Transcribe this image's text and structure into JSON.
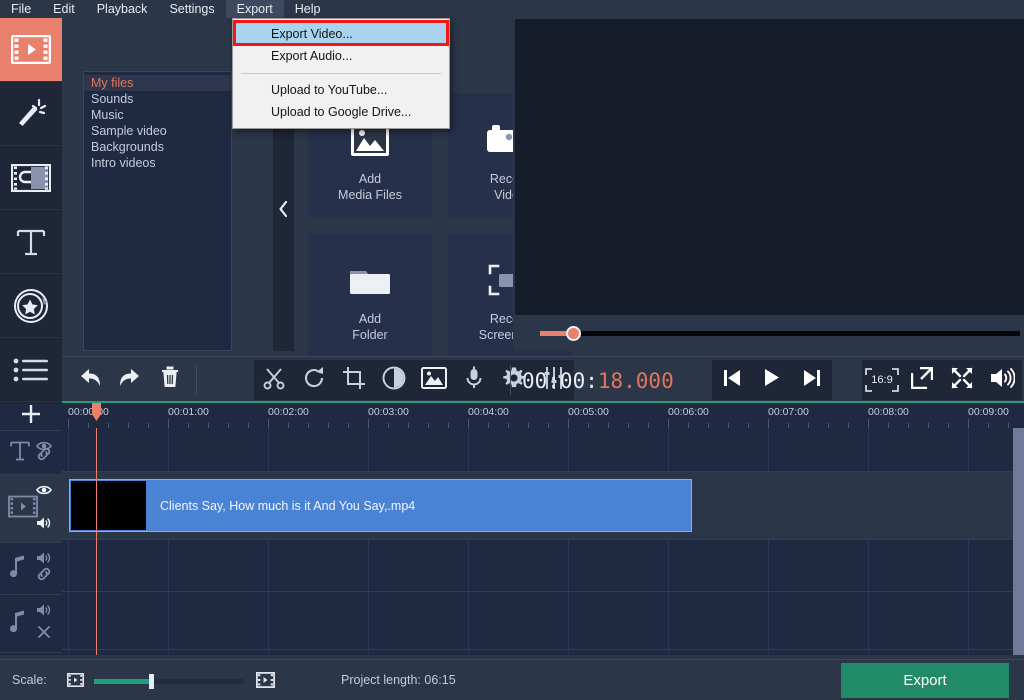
{
  "app": {
    "accent_salmon": "#e8806b",
    "accent_green": "#218b68",
    "clip_blue": "#4a82d4"
  },
  "menubar": {
    "items": [
      {
        "label": "File"
      },
      {
        "label": "Edit"
      },
      {
        "label": "Playback"
      },
      {
        "label": "Settings"
      },
      {
        "label": "Export"
      },
      {
        "label": "Help"
      }
    ]
  },
  "dropdown": {
    "items": [
      {
        "label": "Export Video...",
        "highlighted": true
      },
      {
        "label": "Export Audio...",
        "highlighted": false
      },
      {
        "label": "Upload to YouTube...",
        "highlighted": false
      },
      {
        "label": "Upload to Google Drive...",
        "highlighted": false
      }
    ]
  },
  "rail": {
    "items": [
      {
        "name": "import",
        "selected": true
      },
      {
        "name": "filters",
        "selected": false
      },
      {
        "name": "transitions",
        "selected": false
      },
      {
        "name": "titles",
        "selected": false
      },
      {
        "name": "stickers",
        "selected": false
      },
      {
        "name": "more",
        "selected": false
      }
    ]
  },
  "media_panel": {
    "file_list": [
      {
        "label": "My files",
        "selected": true
      },
      {
        "label": "Sounds",
        "selected": false
      },
      {
        "label": "Music",
        "selected": false
      },
      {
        "label": "Sample video",
        "selected": false
      },
      {
        "label": "Backgrounds",
        "selected": false
      },
      {
        "label": "Intro videos",
        "selected": false
      }
    ],
    "tiles": [
      {
        "label": "Add\nMedia Files",
        "icon": "picture-icon"
      },
      {
        "label": "Record\nVideo",
        "icon": "camcorder-icon"
      },
      {
        "label": "Add\nFolder",
        "icon": "folder-icon"
      },
      {
        "label": "Record\nScreencast",
        "icon": "screencast-icon"
      }
    ]
  },
  "player": {
    "timecode_prefix": "00:00:",
    "timecode_suffix": "18.000",
    "aspect_ratio": "16:9",
    "seek_percent": 6
  },
  "toolbar": {
    "buttons": [
      "undo-icon",
      "redo-icon",
      "delete-icon",
      "split-icon",
      "rotate-icon",
      "crop-icon",
      "color-adjust-icon",
      "stabilize-icon",
      "record-audio-icon",
      "clip-properties-icon",
      "equalizer-icon"
    ],
    "player_buttons": [
      "previous-frame-icon",
      "play-icon",
      "next-frame-icon"
    ],
    "right_buttons": [
      "aspect-ratio-button",
      "popout-icon",
      "fullscreen-icon",
      "volume-icon"
    ]
  },
  "timeline": {
    "ruler_labels": [
      "00:00:00",
      "00:01:00",
      "00:02:00",
      "00:03:00",
      "00:04:00",
      "00:05:00",
      "00:06:00",
      "00:07:00",
      "00:08:00",
      "00:09:00"
    ],
    "tracks": [
      {
        "name": "title-track",
        "icons": [
          "eye-icon",
          "link-icon"
        ],
        "highlighted": false
      },
      {
        "name": "video-track",
        "icons": [
          "eye-icon",
          "speaker-icon"
        ],
        "highlighted": true
      },
      {
        "name": "audio-track",
        "icons": [
          "speaker-icon",
          "link-icon"
        ],
        "highlighted": false
      },
      {
        "name": "audio-track-2",
        "icons": [
          "speaker-icon",
          "unlink-icon"
        ],
        "highlighted": false
      }
    ],
    "clip": {
      "label": "Clients Say, How much is it And You Say,.mp4"
    }
  },
  "statusbar": {
    "scale_label": "Scale:",
    "scale_percent": 37,
    "project_length": "Project length:  06:15",
    "export_label": "Export"
  }
}
